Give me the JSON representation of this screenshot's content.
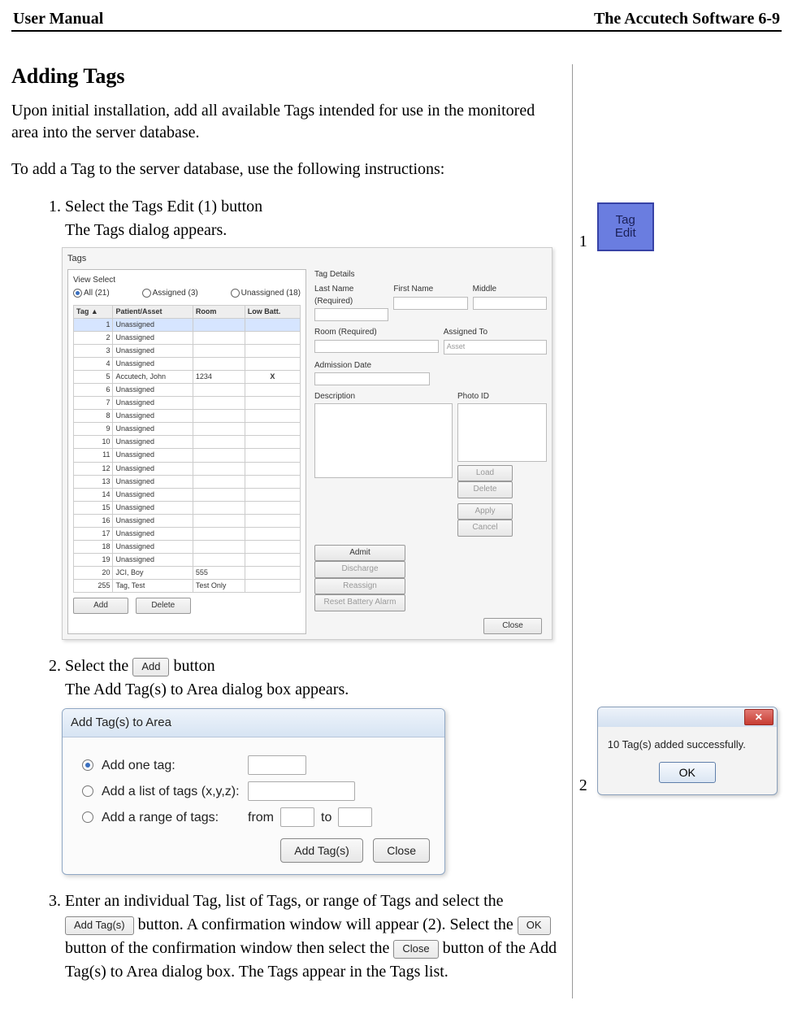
{
  "header": {
    "left": "User Manual",
    "right": "The Accutech Software 6-9"
  },
  "section_title": "Adding Tags",
  "intro1": "Upon initial installation, add all available Tags intended for use in the monitored area into the server database.",
  "intro2": "To add a Tag to the server database, use the following instructions:",
  "steps": {
    "one_a": "Select the Tags Edit (1) button",
    "one_b": "The Tags dialog appears.",
    "two_a": "Select the ",
    "two_btn": "Add",
    "two_b": " button",
    "two_c": "The Add Tag(s) to Area dialog box appears.",
    "three_a": "Enter an individual Tag, list of Tags, or range of Tags and select the ",
    "three_btn1": "Add Tag(s)",
    "three_b": " button. A confirmation window will appear (2). Select the ",
    "three_btn2": "OK",
    "three_c": " button of the confirmation window then select the ",
    "three_btn3": "Close",
    "three_d": " button of the Add Tag(s) to Area dialog box. The Tags appear in the Tags list."
  },
  "tags_dialog": {
    "title": "Tags",
    "view_select_label": "View Select",
    "view_all": "All (21)",
    "view_assigned": "Assigned (3)",
    "view_unassigned": "Unassigned (18)",
    "cols": {
      "tag": "Tag",
      "arrow": "▲",
      "patient": "Patient/Asset",
      "room": "Room",
      "lowbatt": "Low Batt."
    },
    "rows": [
      {
        "n": "1",
        "p": "Unassigned",
        "r": "",
        "b": ""
      },
      {
        "n": "2",
        "p": "Unassigned",
        "r": "",
        "b": ""
      },
      {
        "n": "3",
        "p": "Unassigned",
        "r": "",
        "b": ""
      },
      {
        "n": "4",
        "p": "Unassigned",
        "r": "",
        "b": ""
      },
      {
        "n": "5",
        "p": "Accutech, John",
        "r": "1234",
        "b": "X"
      },
      {
        "n": "6",
        "p": "Unassigned",
        "r": "",
        "b": ""
      },
      {
        "n": "7",
        "p": "Unassigned",
        "r": "",
        "b": ""
      },
      {
        "n": "8",
        "p": "Unassigned",
        "r": "",
        "b": ""
      },
      {
        "n": "9",
        "p": "Unassigned",
        "r": "",
        "b": ""
      },
      {
        "n": "10",
        "p": "Unassigned",
        "r": "",
        "b": ""
      },
      {
        "n": "11",
        "p": "Unassigned",
        "r": "",
        "b": ""
      },
      {
        "n": "12",
        "p": "Unassigned",
        "r": "",
        "b": ""
      },
      {
        "n": "13",
        "p": "Unassigned",
        "r": "",
        "b": ""
      },
      {
        "n": "14",
        "p": "Unassigned",
        "r": "",
        "b": ""
      },
      {
        "n": "15",
        "p": "Unassigned",
        "r": "",
        "b": ""
      },
      {
        "n": "16",
        "p": "Unassigned",
        "r": "",
        "b": ""
      },
      {
        "n": "17",
        "p": "Unassigned",
        "r": "",
        "b": ""
      },
      {
        "n": "18",
        "p": "Unassigned",
        "r": "",
        "b": ""
      },
      {
        "n": "19",
        "p": "Unassigned",
        "r": "",
        "b": ""
      },
      {
        "n": "20",
        "p": "JCI, Boy",
        "r": "555",
        "b": ""
      },
      {
        "n": "255",
        "p": "Tag, Test",
        "r": "Test Only",
        "b": ""
      }
    ],
    "add_btn": "Add",
    "delete_btn": "Delete",
    "details_label": "Tag Details",
    "last_name": "Last Name (Required)",
    "first_name": "First Name",
    "middle": "Middle",
    "room_req": "Room (Required)",
    "assigned_to": "Assigned To",
    "assigned_val": "Asset",
    "admission": "Admission Date",
    "description": "Description",
    "photo_id": "Photo ID",
    "load": "Load",
    "delete2": "Delete",
    "apply": "Apply",
    "cancel": "Cancel",
    "admit": "Admit",
    "discharge": "Discharge",
    "reassign": "Reassign",
    "reset": "Reset Battery Alarm",
    "close": "Close"
  },
  "addtags_dialog": {
    "title": "Add Tag(s) to Area",
    "opt1": "Add one tag:",
    "opt2": "Add a list of tags (x,y,z):",
    "opt3": "Add a range of tags:",
    "from": "from",
    "to": "to",
    "add_btn": "Add Tag(s)",
    "close_btn": "Close"
  },
  "callouts": {
    "one": "1",
    "two": "2",
    "tagedit_label": "Tag\nEdit"
  },
  "confirm": {
    "msg": "10 Tag(s) added successfully.",
    "ok": "OK"
  }
}
